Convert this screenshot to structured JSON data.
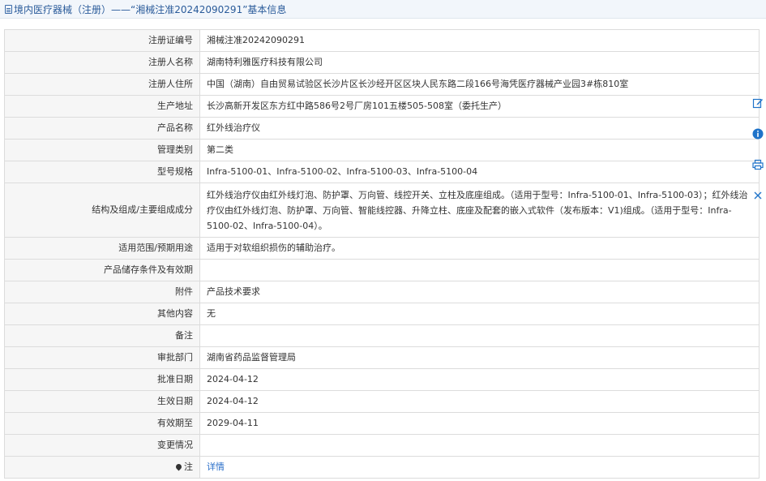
{
  "header": {
    "title": "境内医疗器械（注册）——“湘械注准20242090291”基本信息"
  },
  "rows": [
    {
      "label": "注册证编号",
      "value": "湘械注准20242090291"
    },
    {
      "label": "注册人名称",
      "value": "湖南特利雅医疗科技有限公司"
    },
    {
      "label": "注册人住所",
      "value": "中国（湖南）自由贸易试验区长沙片区长沙经开区区块人民东路二段166号海凭医疗器械产业园3#栋810室"
    },
    {
      "label": "生产地址",
      "value": "长沙高新开发区东方红中路586号2号厂房101五楼505-508室（委托生产）"
    },
    {
      "label": "产品名称",
      "value": "红外线治疗仪"
    },
    {
      "label": "管理类别",
      "value": "第二类"
    },
    {
      "label": "型号规格",
      "value": "Infra-5100-01、Infra-5100-02、Infra-5100-03、Infra-5100-04"
    },
    {
      "label": "结构及组成/主要组成成分",
      "value": "红外线治疗仪由红外线灯泡、防护罩、万向管、线控开关、立柱及底座组成。（适用于型号：Infra-5100-01、Infra-5100-03）；红外线治疗仪由红外线灯泡、防护罩、万向管、智能线控器、升降立柱、底座及配套的嵌入式软件（发布版本：V1)组成。（适用于型号：Infra-5100-02、Infra-5100-04）。"
    },
    {
      "label": "适用范围/预期用途",
      "value": "适用于对软组织损伤的辅助治疗。"
    },
    {
      "label": "产品储存条件及有效期",
      "value": ""
    },
    {
      "label": "附件",
      "value": "产品技术要求"
    },
    {
      "label": "其他内容",
      "value": "无"
    },
    {
      "label": "备注",
      "value": ""
    },
    {
      "label": "审批部门",
      "value": "湖南省药品监督管理局"
    },
    {
      "label": "批准日期",
      "value": "2024-04-12"
    },
    {
      "label": "生效日期",
      "value": "2024-04-12"
    },
    {
      "label": "有效期至",
      "value": "2029-04-11"
    },
    {
      "label": "变更情况",
      "value": ""
    },
    {
      "label": "注",
      "value": "详情"
    }
  ],
  "side_tools": [
    {
      "icon": "edit-icon"
    },
    {
      "icon": "info-icon"
    },
    {
      "icon": "print-icon"
    },
    {
      "icon": "close-icon"
    }
  ],
  "colors": {
    "header_text": "#2a5b9a",
    "label_bg": "#f6f6f6",
    "border": "#dcdcdc",
    "link": "#2a6fc9",
    "tool_blue": "#1f73c9"
  }
}
